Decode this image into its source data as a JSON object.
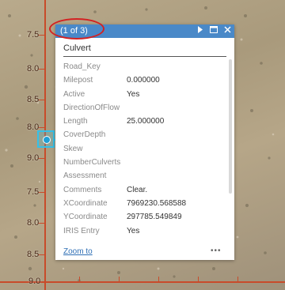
{
  "map": {
    "tick_labels_left": [
      "7.5",
      "8.0",
      "8.5",
      "8.0",
      "9.0",
      "7.5",
      "8.0",
      "8.5",
      "9.0"
    ],
    "tick_labels_bottom": [
      "9"
    ]
  },
  "popup": {
    "count": "(1 of 3)",
    "title": "Culvert",
    "fields": [
      {
        "key": "Road_Key",
        "value": ""
      },
      {
        "key": "Milepost",
        "value": "0.000000"
      },
      {
        "key": "Active",
        "value": "Yes"
      },
      {
        "key": "DirectionOfFlow",
        "value": ""
      },
      {
        "key": "Length",
        "value": "25.000000"
      },
      {
        "key": "CoverDepth",
        "value": ""
      },
      {
        "key": "Skew",
        "value": ""
      },
      {
        "key": "NumberCulverts",
        "value": ""
      },
      {
        "key": "Assessment",
        "value": ""
      },
      {
        "key": "Comments",
        "value": "Clear."
      },
      {
        "key": "XCoordinate",
        "value": "7969230.568588"
      },
      {
        "key": "YCoordinate",
        "value": "297785.549849"
      },
      {
        "key": "IRIS Entry",
        "value": "Yes"
      }
    ],
    "zoom_label": "Zoom to",
    "more_label": "•••",
    "icons": {
      "next": "play-right-icon",
      "maximize": "maximize-icon",
      "close": "close-icon"
    }
  },
  "colors": {
    "header": "#4a89c8",
    "grid": "#c84b2a",
    "marker": "#35c0e8",
    "callout": "#d32222"
  }
}
